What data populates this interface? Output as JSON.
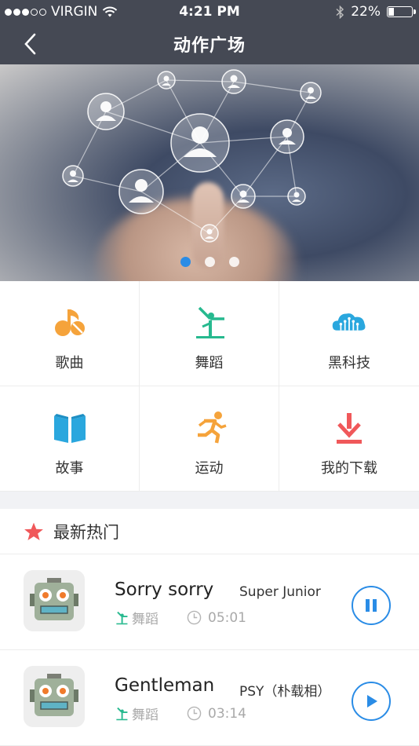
{
  "status_bar": {
    "carrier": "VIRGIN",
    "time": "4:21 PM",
    "battery": "22%",
    "battery_level": 0.22
  },
  "nav": {
    "title": "动作广场",
    "back_icon": "chevron-left-icon"
  },
  "banner": {
    "page_count": 3,
    "active_page": 1
  },
  "categories": [
    {
      "label": "歌曲",
      "icon": "music-note-icon",
      "color": "#f5a33b"
    },
    {
      "label": "舞蹈",
      "icon": "dance-icon",
      "color": "#27b98f"
    },
    {
      "label": "黑科技",
      "icon": "cloud-tech-icon",
      "color": "#2aa7de"
    },
    {
      "label": "故事",
      "icon": "book-icon",
      "color": "#2aa7de"
    },
    {
      "label": "运动",
      "icon": "running-icon",
      "color": "#f5a33b"
    },
    {
      "label": "我的下载",
      "icon": "download-icon",
      "color": "#f0585a"
    }
  ],
  "hot": {
    "title": "最新热门",
    "star_color": "#f0585a",
    "items": [
      {
        "song": "Sorry sorry",
        "artist": "Super Junior",
        "category": "舞蹈",
        "duration": "05:01",
        "state": "pause"
      },
      {
        "song": "Gentleman",
        "artist": "PSY（朴载相）",
        "category": "舞蹈",
        "duration": "03:14",
        "state": "play"
      }
    ]
  },
  "colors": {
    "nav_bg": "#454954",
    "accent": "#2a8ce6",
    "dance_green": "#27b98f"
  }
}
